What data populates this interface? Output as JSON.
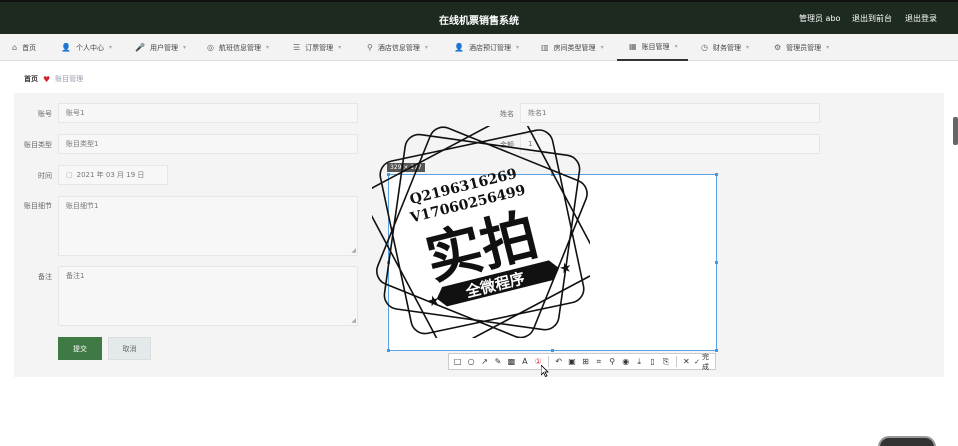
{
  "header": {
    "title": "在线机票销售系统",
    "user": "管理员 abo",
    "back_to_front": "退出到前台",
    "logout": "退出登录"
  },
  "nav": {
    "items": [
      {
        "label": "首页",
        "icon": "home-icon"
      },
      {
        "label": "个人中心",
        "icon": "person-icon"
      },
      {
        "label": "用户管理",
        "icon": "mic-icon"
      },
      {
        "label": "航班信息管理",
        "icon": "compass-icon"
      },
      {
        "label": "订票管理",
        "icon": "list-icon"
      },
      {
        "label": "酒店信息管理",
        "icon": "location-icon"
      },
      {
        "label": "酒店预订管理",
        "icon": "person-icon"
      },
      {
        "label": "房间类型管理",
        "icon": "bar-chart-icon"
      },
      {
        "label": "账目管理",
        "icon": "calendar-icon"
      },
      {
        "label": "财务管理",
        "icon": "clock-icon"
      },
      {
        "label": "管理员管理",
        "icon": "gear-icon"
      }
    ]
  },
  "breadcrumb": {
    "home": "首页",
    "current": "账目管理"
  },
  "form": {
    "account_label": "账号",
    "account_value": "账号1",
    "name_label": "姓名",
    "name_value": "姓名1",
    "type_label": "账目类型",
    "type_value": "账目类型1",
    "amount_label": "金额",
    "amount_value": "1",
    "time_label": "时间",
    "time_value": "2021 年 03 月 19 日",
    "detail_label": "账目细节",
    "detail_value": "账目细节1",
    "remark_label": "备注",
    "remark_value": "备注1",
    "submit": "提交",
    "cancel": "取消"
  },
  "screenshot_overlay": {
    "dimensions": "329 × 177",
    "done": "完成"
  },
  "watermark": {
    "line1": "Q2196316269",
    "line2": "V17060256499",
    "big": "实拍",
    "ribbon": "全微程序"
  },
  "colors": {
    "topbar": "#1c2a1f",
    "submit": "#3f7a44",
    "heart": "#d0232f",
    "selection": "#5aa2e2"
  }
}
